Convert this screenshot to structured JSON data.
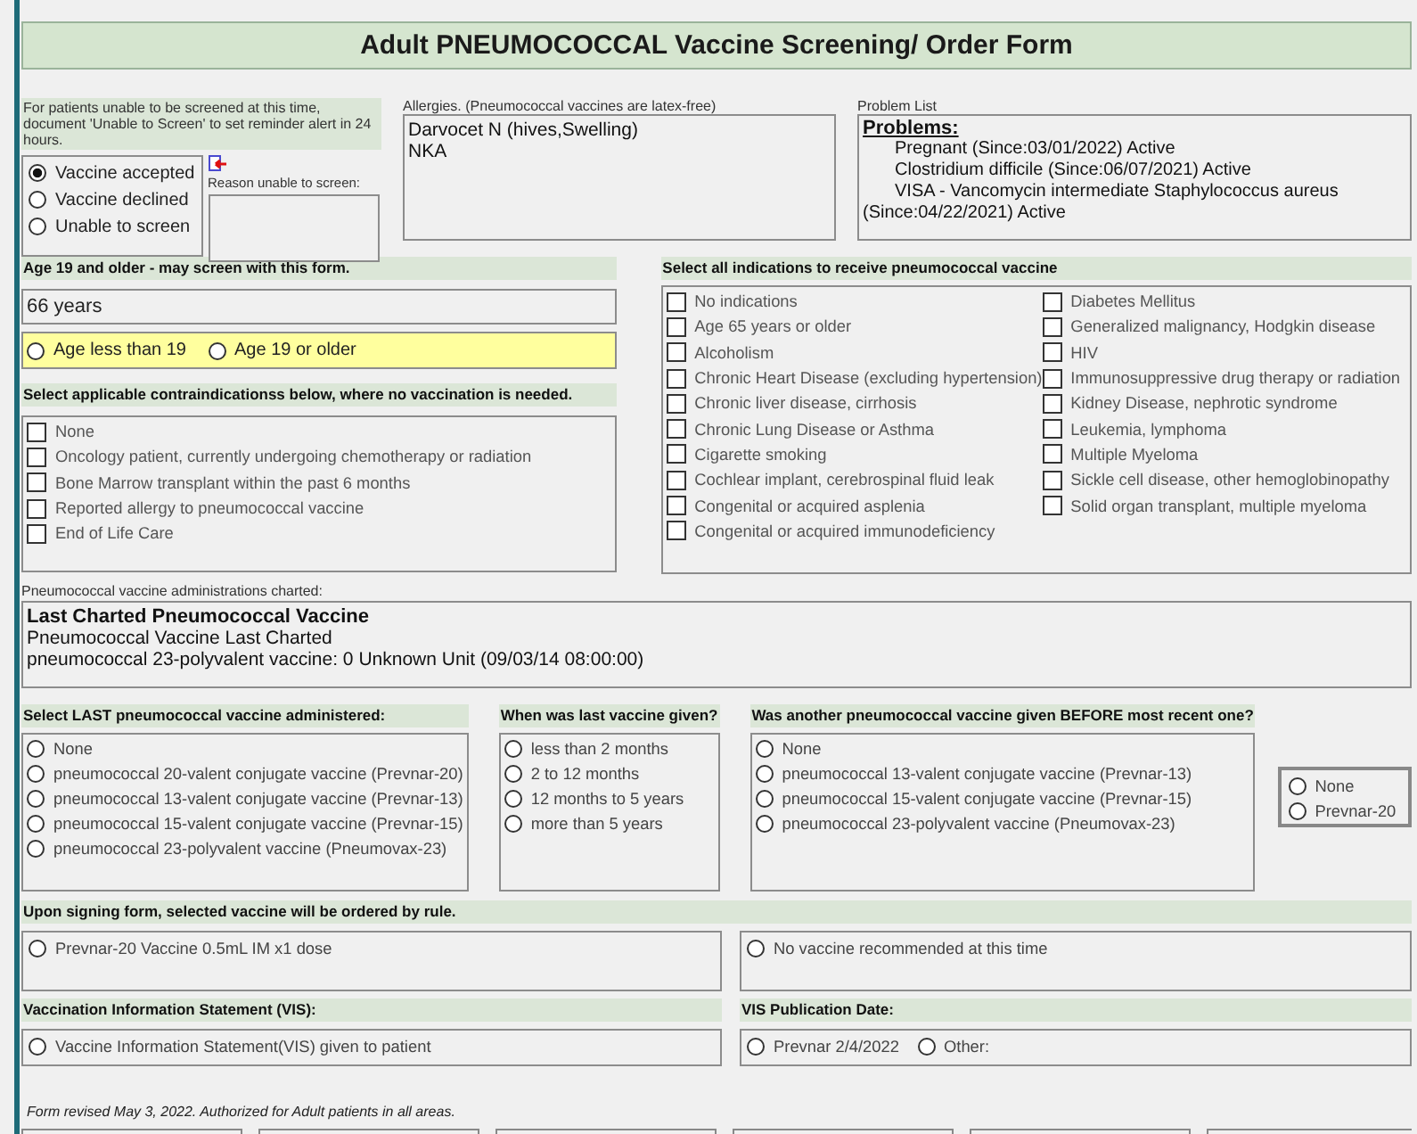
{
  "title": "Adult PNEUMOCOCCAL Vaccine Screening/ Order Form",
  "screening": {
    "note": "For patients unable to be screened at this time, document 'Unable to Screen' to set reminder alert in 24 hours.",
    "options": [
      {
        "label": "Vaccine accepted",
        "selected": true
      },
      {
        "label": "Vaccine declined",
        "selected": false
      },
      {
        "label": "Unable to screen",
        "selected": false
      }
    ],
    "reason_label": "Reason unable to screen:"
  },
  "allergies": {
    "label": "Allergies.  (Pneumococcal vaccines are latex-free)",
    "lines": [
      "Darvocet N (hives,Swelling)",
      "NKA"
    ]
  },
  "problem_list": {
    "label": "Problem List",
    "heading": "Problems:",
    "items": [
      "Pregnant (Since:03/01/2022)  Active",
      "Clostridium difficile (Since:06/07/2021)  Active",
      "VISA - Vancomycin intermediate Staphylococcus aureus (Since:04/22/2021)  Active"
    ]
  },
  "age": {
    "header": "Age 19 and older - may screen with this form.",
    "value": "66 years",
    "options": [
      {
        "label": "Age less than 19",
        "selected": false
      },
      {
        "label": "Age 19 or older",
        "selected": false
      }
    ]
  },
  "contraindications": {
    "header": "Select applicable contraindicationss below, where no vaccination is needed.",
    "items": [
      {
        "label": "None",
        "checked": false
      },
      {
        "label": "Oncology patient, currently undergoing chemotherapy or radiation",
        "checked": false
      },
      {
        "label": "Bone Marrow transplant within the past 6 months",
        "checked": false
      },
      {
        "label": "Reported allergy to pneumococcal vaccine",
        "checked": false
      },
      {
        "label": "End of Life Care",
        "checked": false
      }
    ]
  },
  "indications": {
    "header": "Select all indications to receive pneumococcal vaccine",
    "items": [
      {
        "label": "No indications",
        "checked": false
      },
      {
        "label": "Age 65 years or older",
        "checked": false
      },
      {
        "label": "Alcoholism",
        "checked": false
      },
      {
        "label": "Chronic Heart Disease (excluding hypertension)",
        "checked": false
      },
      {
        "label": "Chronic liver disease, cirrhosis",
        "checked": false
      },
      {
        "label": "Chronic Lung Disease or Asthma",
        "checked": false
      },
      {
        "label": "Cigarette smoking",
        "checked": false
      },
      {
        "label": "Cochlear implant, cerebrospinal fluid leak",
        "checked": false
      },
      {
        "label": "Congenital or acquired asplenia",
        "checked": false
      },
      {
        "label": "Congenital or acquired immunodeficiency",
        "checked": false
      },
      {
        "label": "Diabetes Mellitus",
        "checked": false
      },
      {
        "label": "Generalized malignancy, Hodgkin disease",
        "checked": false
      },
      {
        "label": "HIV",
        "checked": false
      },
      {
        "label": "Immunosuppressive drug therapy or radiation",
        "checked": false
      },
      {
        "label": "Kidney Disease, nephrotic syndrome",
        "checked": false
      },
      {
        "label": "Leukemia, lymphoma",
        "checked": false
      },
      {
        "label": "Multiple Myeloma",
        "checked": false
      },
      {
        "label": "Sickle cell disease, other hemoglobinopathy",
        "checked": false
      },
      {
        "label": "Solid organ transplant, multiple myeloma",
        "checked": false
      }
    ]
  },
  "charted": {
    "label": "Pneumococcal vaccine administrations charted:",
    "heading": "Last Charted Pneumococcal Vaccine",
    "lines": [
      "Pneumococcal Vaccine Last Charted",
      "pneumococcal 23-polyvalent vaccine: 0 Unknown Unit (09/03/14 08:00:00)"
    ]
  },
  "last_vaccine": {
    "header": "Select LAST pneumococcal vaccine administered:",
    "options": [
      {
        "label": "None",
        "selected": false
      },
      {
        "label": "pneumococcal 20-valent conjugate vaccine (Prevnar-20)",
        "selected": false
      },
      {
        "label": "pneumococcal 13-valent conjugate vaccine (Prevnar-13)",
        "selected": false
      },
      {
        "label": "pneumococcal 15-valent conjugate vaccine (Prevnar-15)",
        "selected": false
      },
      {
        "label": "pneumococcal 23-polyvalent vaccine (Pneumovax-23)",
        "selected": false
      }
    ]
  },
  "when_given": {
    "header": "When was last vaccine given?",
    "options": [
      {
        "label": "less than 2 months",
        "selected": false
      },
      {
        "label": "2 to 12 months",
        "selected": false
      },
      {
        "label": "12 months to 5 years",
        "selected": false
      },
      {
        "label": "more than 5 years",
        "selected": false
      }
    ]
  },
  "given_before": {
    "header": "Was another pneumococcal vaccine given BEFORE  most recent one?",
    "options": [
      {
        "label": "None",
        "selected": false
      },
      {
        "label": "pneumococcal 13-valent conjugate vaccine (Prevnar-13)",
        "selected": false
      },
      {
        "label": "pneumococcal 15-valent conjugate vaccine (Prevnar-15)",
        "selected": false
      },
      {
        "label": "pneumococcal 23-polyvalent vaccine (Pneumovax-23)",
        "selected": false
      }
    ]
  },
  "side_choice": {
    "options": [
      {
        "label": "None",
        "selected": false
      },
      {
        "label": "Prevnar-20",
        "selected": false
      }
    ]
  },
  "order": {
    "header": "Upon signing form, selected vaccine will be ordered by rule.",
    "options": [
      {
        "label": "Prevnar-20 Vaccine 0.5mL IM x1 dose",
        "selected": false
      },
      {
        "label": "No vaccine recommended at this time",
        "selected": false
      }
    ]
  },
  "vis": {
    "header": "Vaccination Information Statement (VIS):",
    "options": [
      {
        "label": "Vaccine Information Statement(VIS) given to patient",
        "selected": false
      }
    ]
  },
  "vis_date": {
    "header": "VIS Publication Date:",
    "options": [
      {
        "label": "Prevnar 2/4/2022",
        "selected": false
      },
      {
        "label": "Other:",
        "selected": false
      }
    ]
  },
  "footer": "Form revised May 3, 2022.   Authorized for Adult patients in all areas.",
  "bottom_buttons": [
    {
      "kind": "button"
    },
    {
      "kind": "button"
    },
    {
      "kind": "button"
    },
    {
      "kind": "button"
    },
    {
      "kind": "button"
    },
    {
      "kind": "button"
    }
  ]
}
